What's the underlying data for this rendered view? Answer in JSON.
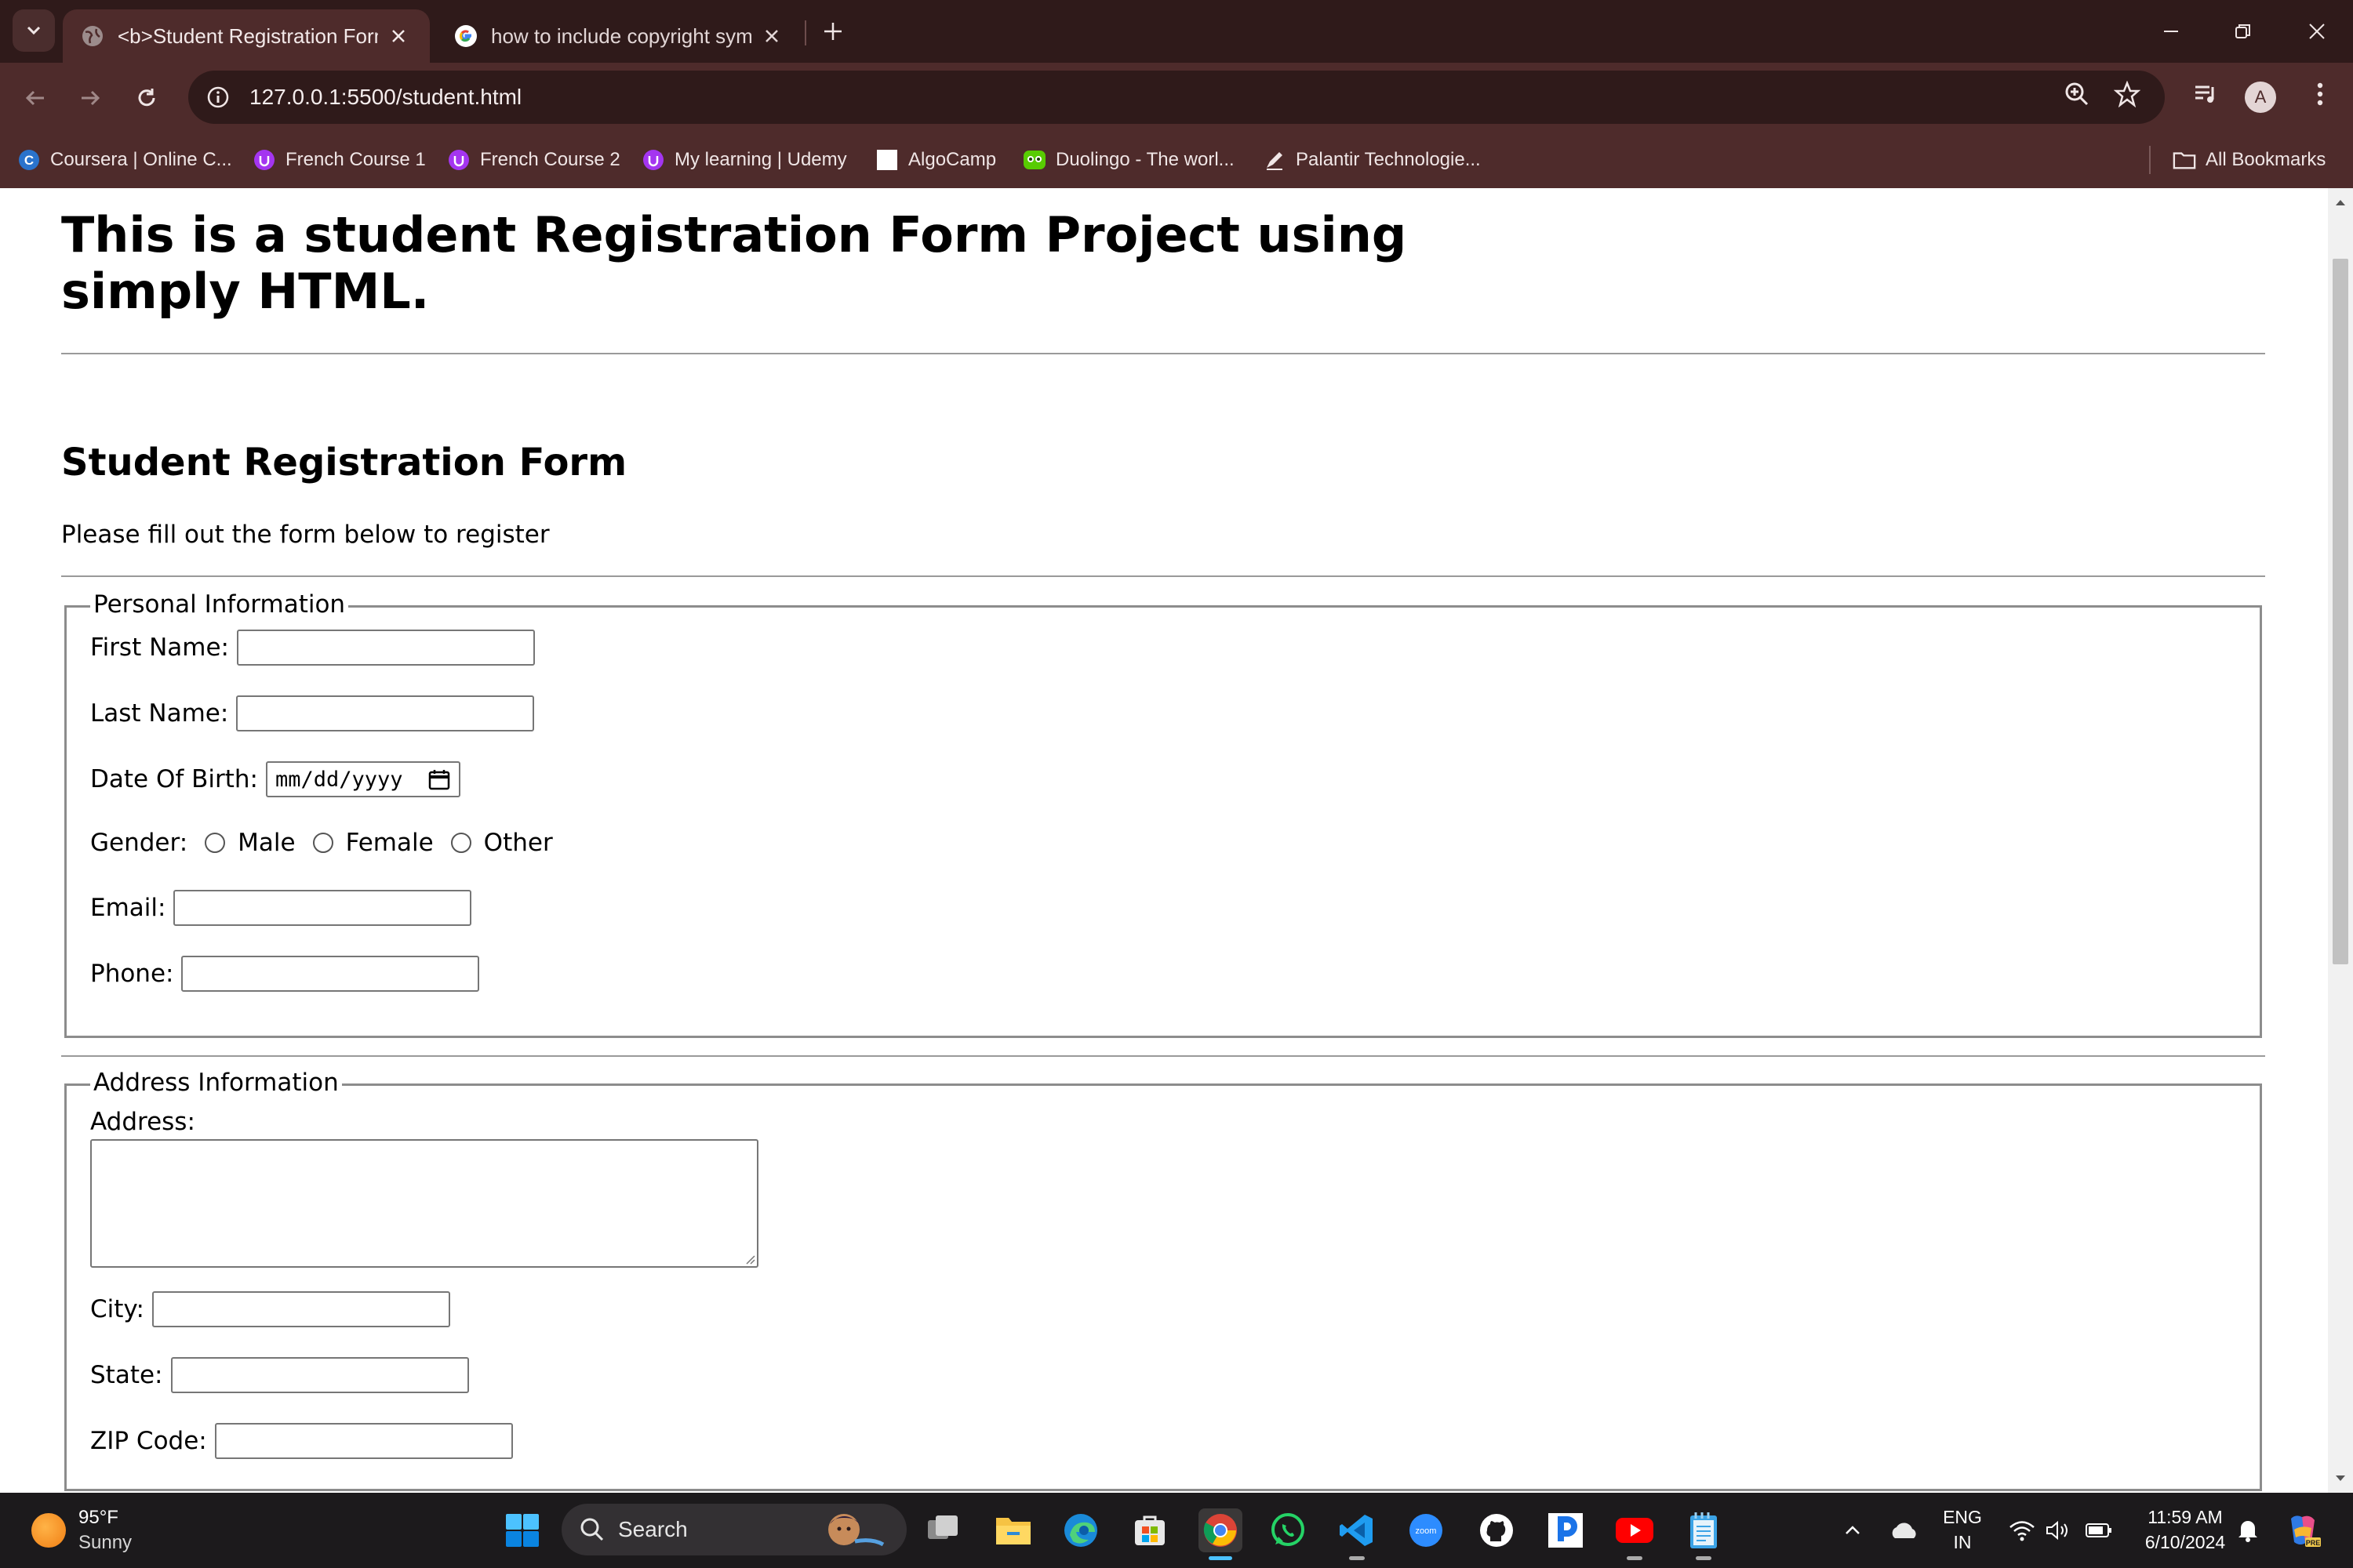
{
  "browser": {
    "tabs": [
      {
        "title": "<b>Student Registration Form</b>",
        "active": true
      },
      {
        "title": "how to include copyright symbol",
        "active": false
      }
    ],
    "url": "127.0.0.1:5500/student.html",
    "profile_initial": "A",
    "bookmarks": [
      {
        "label": "Coursera | Online C...",
        "icon": "coursera-icon"
      },
      {
        "label": "French Course 1",
        "icon": "udemy-icon"
      },
      {
        "label": "French Course 2",
        "icon": "udemy-icon"
      },
      {
        "label": "My learning | Udemy",
        "icon": "udemy-icon"
      },
      {
        "label": "AlgoCamp",
        "icon": "blank-page-icon"
      },
      {
        "label": "Duolingo - The worl...",
        "icon": "duolingo-icon"
      },
      {
        "label": "Palantir Technologie...",
        "icon": "palantir-icon"
      }
    ],
    "all_bookmarks_label": "All Bookmarks"
  },
  "page": {
    "main_heading": "This is a student Registration Form Project using simply HTML.",
    "form_title": "Student Registration Form",
    "instruction": "Please fill out the form below to register",
    "personal": {
      "legend": "Personal Information",
      "first_name_label": "First Name:",
      "last_name_label": "Last Name:",
      "dob_label": "Date Of Birth:",
      "dob_placeholder": "mm/dd/yyyy",
      "gender_label": "Gender:",
      "gender_options": [
        "Male",
        "Female",
        "Other"
      ],
      "email_label": "Email:",
      "phone_label": "Phone:"
    },
    "address": {
      "legend": "Address Information",
      "address_label": "Address:",
      "city_label": "City:",
      "state_label": "State:",
      "zip_label": "ZIP Code:"
    }
  },
  "taskbar": {
    "weather_temp": "95°F",
    "weather_condition": "Sunny",
    "search_label": "Search",
    "language": "ENG",
    "region": "IN",
    "time": "11:59 AM",
    "date": "6/10/2024"
  }
}
